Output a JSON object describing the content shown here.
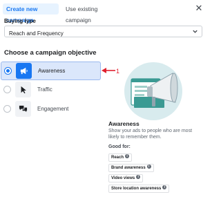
{
  "tabs": [
    {
      "label": "Create new campaign"
    },
    {
      "label": "Use existing campaign"
    }
  ],
  "buying": {
    "label": "Buying type",
    "value": "Reach and Frequency"
  },
  "objective": {
    "title": "Choose a campaign objective",
    "options": [
      {
        "label": "Awareness",
        "icon": "megaphone-icon",
        "selected": true
      },
      {
        "label": "Traffic",
        "icon": "cursor-icon",
        "selected": false
      },
      {
        "label": "Engagement",
        "icon": "chat-bubbles-icon",
        "selected": false
      }
    ]
  },
  "annotation": {
    "number": "1",
    "color": "#e0202e"
  },
  "detail": {
    "title": "Awareness",
    "description": "Show your ads to people who are most likely to remember them.",
    "good_for_label": "Good for:",
    "tags": [
      "Reach",
      "Brand awareness",
      "Video views",
      "Store location awareness"
    ]
  },
  "colors": {
    "accent": "#1877f2",
    "selected_bg": "#dbe7fb",
    "illustration_bg": "#d8ebee",
    "illustration_accent": "#3a9a93"
  }
}
